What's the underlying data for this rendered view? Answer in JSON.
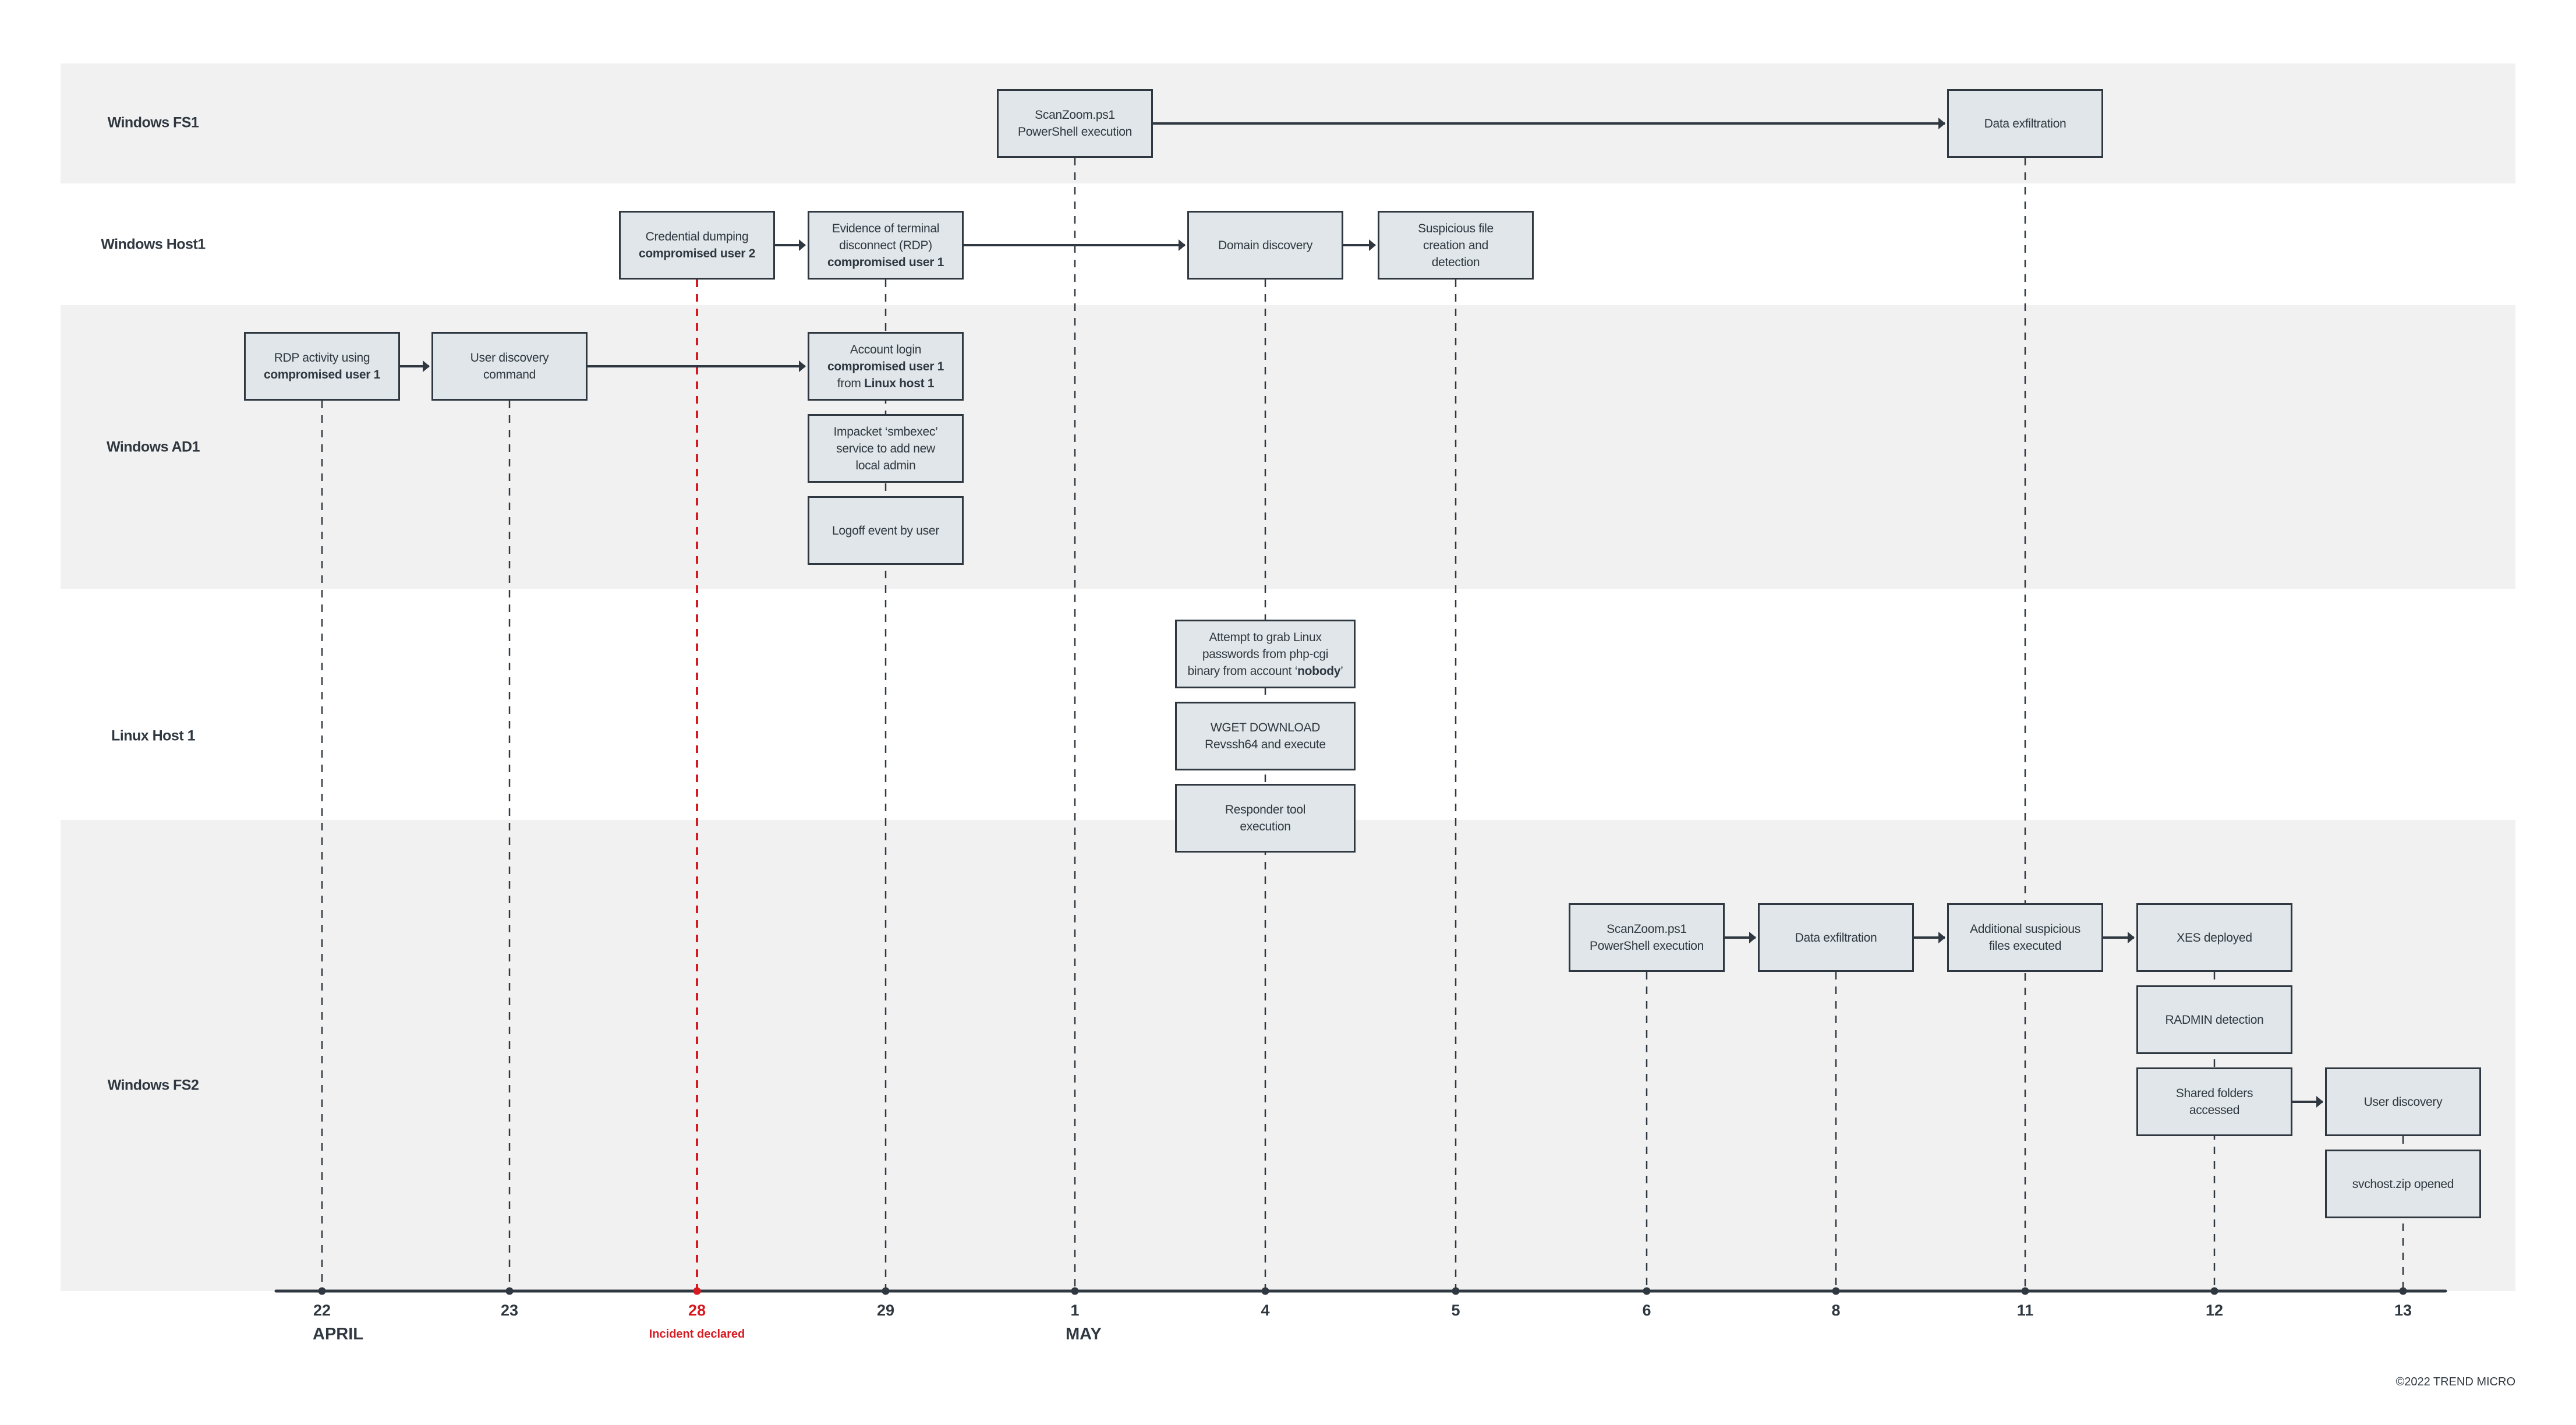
{
  "diagram": {
    "type": "incident-timeline",
    "copyright": "©2022 TREND MICRO",
    "colors": {
      "band": "#f1f1f1",
      "box_fill": "#e0e6e9",
      "ink": "#2f3840",
      "incident": "#d71920"
    },
    "lanes": [
      {
        "id": "fs1",
        "label": "Windows FS1",
        "shaded": true
      },
      {
        "id": "host1",
        "label": "Windows Host1",
        "shaded": false
      },
      {
        "id": "ad1",
        "label": "Windows AD1",
        "shaded": true
      },
      {
        "id": "linux1",
        "label": "Linux Host 1",
        "shaded": false
      },
      {
        "id": "fs2",
        "label": "Windows FS2",
        "shaded": true
      }
    ],
    "timeline": {
      "dates": [
        {
          "id": "apr22",
          "day": "22",
          "month": "APRIL"
        },
        {
          "id": "apr23",
          "day": "23"
        },
        {
          "id": "apr28",
          "day": "28",
          "highlight": true,
          "annotation": "Incident declared"
        },
        {
          "id": "apr29",
          "day": "29"
        },
        {
          "id": "may1",
          "day": "1",
          "month": "MAY"
        },
        {
          "id": "may4",
          "day": "4"
        },
        {
          "id": "may5",
          "day": "5"
        },
        {
          "id": "may6",
          "day": "6"
        },
        {
          "id": "may8",
          "day": "8"
        },
        {
          "id": "may11",
          "day": "11"
        },
        {
          "id": "may12",
          "day": "12"
        },
        {
          "id": "may13",
          "day": "13"
        }
      ]
    },
    "events": [
      {
        "id": "e1",
        "lane": "fs1",
        "date": "may1",
        "stack": 0,
        "lines": [
          [
            {
              "t": "ScanZoom.ps1"
            }
          ],
          [
            {
              "t": "PowerShell execution"
            }
          ]
        ]
      },
      {
        "id": "e2",
        "lane": "fs1",
        "date": "may11",
        "stack": 0,
        "lines": [
          [
            {
              "t": "Data exfiltration"
            }
          ]
        ]
      },
      {
        "id": "e3",
        "lane": "host1",
        "date": "apr28",
        "stack": 0,
        "lines": [
          [
            {
              "t": "Credential dumping"
            }
          ],
          [
            {
              "t": "compromised user 2",
              "b": true
            }
          ]
        ]
      },
      {
        "id": "e4",
        "lane": "host1",
        "date": "apr29",
        "stack": 0,
        "lines": [
          [
            {
              "t": "Evidence of terminal"
            }
          ],
          [
            {
              "t": "disconnect (RDP)"
            }
          ],
          [
            {
              "t": "compromised user 1",
              "b": true
            }
          ]
        ]
      },
      {
        "id": "e5",
        "lane": "host1",
        "date": "may4",
        "stack": 0,
        "lines": [
          [
            {
              "t": "Domain discovery"
            }
          ]
        ]
      },
      {
        "id": "e6",
        "lane": "host1",
        "date": "may5",
        "stack": 0,
        "lines": [
          [
            {
              "t": "Suspicious file"
            }
          ],
          [
            {
              "t": "creation and"
            }
          ],
          [
            {
              "t": "detection"
            }
          ]
        ]
      },
      {
        "id": "e7",
        "lane": "ad1",
        "date": "apr22",
        "stack": 0,
        "lines": [
          [
            {
              "t": "RDP activity using"
            }
          ],
          [
            {
              "t": "compromised user 1",
              "b": true
            }
          ]
        ]
      },
      {
        "id": "e8",
        "lane": "ad1",
        "date": "apr23",
        "stack": 0,
        "lines": [
          [
            {
              "t": "User discovery"
            }
          ],
          [
            {
              "t": "command"
            }
          ]
        ]
      },
      {
        "id": "e9",
        "lane": "ad1",
        "date": "apr29",
        "stack": 0,
        "lines": [
          [
            {
              "t": "Account login"
            }
          ],
          [
            {
              "t": "compromised user 1",
              "b": true
            }
          ],
          [
            {
              "t": "from "
            },
            {
              "t": "Linux host 1",
              "b": true
            }
          ]
        ]
      },
      {
        "id": "e10",
        "lane": "ad1",
        "date": "apr29",
        "stack": 1,
        "lines": [
          [
            {
              "t": "Impacket ‘smbexec’"
            }
          ],
          [
            {
              "t": "service to add new"
            }
          ],
          [
            {
              "t": "local admin"
            }
          ]
        ]
      },
      {
        "id": "e11",
        "lane": "ad1",
        "date": "apr29",
        "stack": 2,
        "lines": [
          [
            {
              "t": "Logoff event by user"
            }
          ]
        ]
      },
      {
        "id": "e12",
        "lane": "linux1",
        "date": "may4",
        "stack": 0,
        "wide": true,
        "lines": [
          [
            {
              "t": "Attempt to grab Linux"
            }
          ],
          [
            {
              "t": "passwords from php-cgi"
            }
          ],
          [
            {
              "t": "binary from account ‘"
            },
            {
              "t": "nobody",
              "b": true
            },
            {
              "t": "’"
            }
          ]
        ]
      },
      {
        "id": "e13",
        "lane": "linux1",
        "date": "may4",
        "stack": 1,
        "wide": true,
        "lines": [
          [
            {
              "t": "WGET DOWNLOAD"
            }
          ],
          [
            {
              "t": "Revssh64 and execute"
            }
          ]
        ]
      },
      {
        "id": "e14",
        "lane": "linux1",
        "date": "may4",
        "stack": 2,
        "wide": true,
        "lines": [
          [
            {
              "t": "Responder tool"
            }
          ],
          [
            {
              "t": "execution"
            }
          ]
        ]
      },
      {
        "id": "e15",
        "lane": "fs2",
        "date": "may6",
        "stack": 0,
        "lines": [
          [
            {
              "t": "ScanZoom.ps1"
            }
          ],
          [
            {
              "t": "PowerShell execution"
            }
          ]
        ]
      },
      {
        "id": "e16",
        "lane": "fs2",
        "date": "may8",
        "stack": 0,
        "lines": [
          [
            {
              "t": "Data exfiltration"
            }
          ]
        ]
      },
      {
        "id": "e17",
        "lane": "fs2",
        "date": "may11",
        "stack": 0,
        "lines": [
          [
            {
              "t": "Additional suspicious"
            }
          ],
          [
            {
              "t": "files executed"
            }
          ]
        ]
      },
      {
        "id": "e18",
        "lane": "fs2",
        "date": "may12",
        "stack": 0,
        "lines": [
          [
            {
              "t": "XES deployed"
            }
          ]
        ]
      },
      {
        "id": "e19",
        "lane": "fs2",
        "date": "may12",
        "stack": 1,
        "lines": [
          [
            {
              "t": "RADMIN detection"
            }
          ]
        ]
      },
      {
        "id": "e20",
        "lane": "fs2",
        "date": "may12",
        "stack": 2,
        "lines": [
          [
            {
              "t": "Shared folders"
            }
          ],
          [
            {
              "t": "accessed"
            }
          ]
        ]
      },
      {
        "id": "e21",
        "lane": "fs2",
        "date": "may13",
        "stack": 2,
        "lines": [
          [
            {
              "t": "User discovery"
            }
          ]
        ]
      },
      {
        "id": "e22",
        "lane": "fs2",
        "date": "may13",
        "stack": 3,
        "lines": [
          [
            {
              "t": "svchost.zip opened"
            }
          ]
        ]
      }
    ],
    "arrows": [
      [
        "e1",
        "e2"
      ],
      [
        "e3",
        "e4"
      ],
      [
        "e4",
        "e5"
      ],
      [
        "e5",
        "e6"
      ],
      [
        "e7",
        "e8"
      ],
      [
        "e8",
        "e9"
      ],
      [
        "e15",
        "e16"
      ],
      [
        "e16",
        "e17"
      ],
      [
        "e17",
        "e18"
      ],
      [
        "e20",
        "e21"
      ]
    ],
    "guides": [
      {
        "date": "apr22",
        "from": "e7"
      },
      {
        "date": "apr23",
        "from": "e8"
      },
      {
        "date": "apr28",
        "from": "e3"
      },
      {
        "date": "apr29",
        "from": "e4"
      },
      {
        "date": "may1",
        "from": "e1"
      },
      {
        "date": "may4",
        "from": "e5"
      },
      {
        "date": "may5",
        "from": "e6"
      },
      {
        "date": "may6",
        "from": "e15"
      },
      {
        "date": "may8",
        "from": "e16"
      },
      {
        "date": "may11",
        "from": "e2"
      },
      {
        "date": "may12",
        "from": "e18"
      },
      {
        "date": "may13",
        "from": "e21"
      }
    ]
  }
}
